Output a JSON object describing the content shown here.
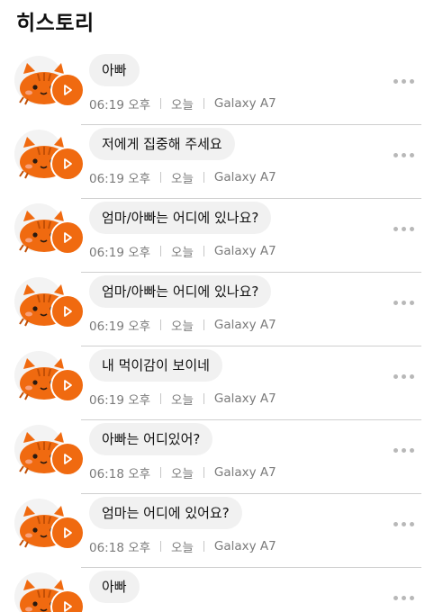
{
  "header": {
    "title": "히스토리"
  },
  "colors": {
    "accent": "#f06a10",
    "bubble": "#f1f1f1",
    "meta_text": "#7b7b7b"
  },
  "icons": {
    "avatar": "orange-cat-avatar-icon",
    "play": "play-icon",
    "more": "more-horizontal-icon"
  },
  "history": [
    {
      "message": "아빠",
      "time": "06:19 오후",
      "day": "오늘",
      "device": "Galaxy A7"
    },
    {
      "message": "저에게 집중해 주세요",
      "time": "06:19 오후",
      "day": "오늘",
      "device": "Galaxy A7"
    },
    {
      "message": "엄마/아빠는 어디에 있나요?",
      "time": "06:19 오후",
      "day": "오늘",
      "device": "Galaxy A7"
    },
    {
      "message": "엄마/아빠는 어디에 있나요?",
      "time": "06:19 오후",
      "day": "오늘",
      "device": "Galaxy A7"
    },
    {
      "message": "내 먹이감이 보이네",
      "time": "06:19 오후",
      "day": "오늘",
      "device": "Galaxy A7"
    },
    {
      "message": "아빠는 어디있어?",
      "time": "06:18 오후",
      "day": "오늘",
      "device": "Galaxy A7"
    },
    {
      "message": "엄마는 어디에 있어요?",
      "time": "06:18 오후",
      "day": "오늘",
      "device": "Galaxy A7"
    },
    {
      "message": "아빠"
    }
  ]
}
